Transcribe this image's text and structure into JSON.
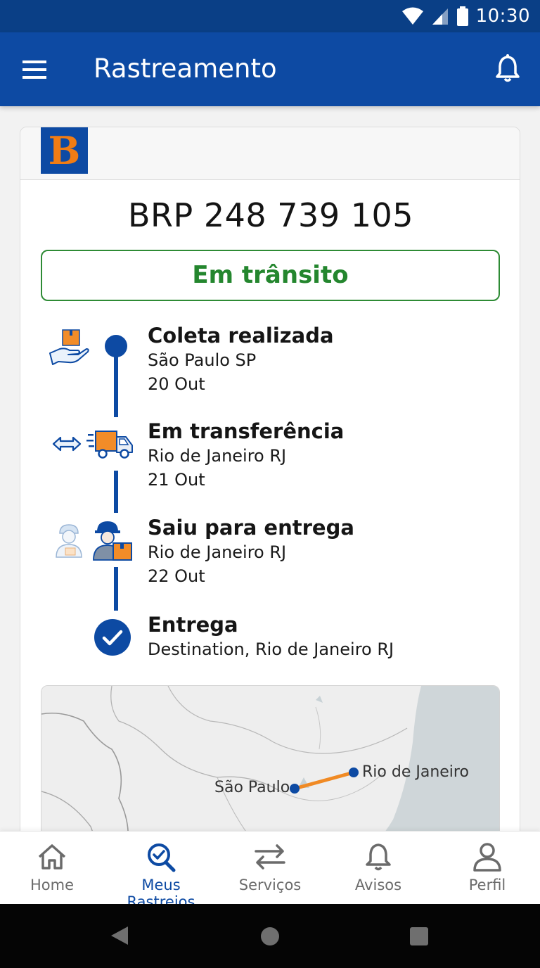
{
  "status_bar": {
    "time": "10:30"
  },
  "app_bar": {
    "title": "Rastreamento"
  },
  "card": {
    "logo_letter": "B",
    "tracking_number": "BRP 248 739 105",
    "status": "Em trânsito",
    "events": [
      {
        "title": "Coleta realizada",
        "location": "São Paulo SP",
        "date": "20 Out"
      },
      {
        "title": "Em transferência",
        "location": "Rio de Janeiro RJ",
        "date": "21 Out"
      },
      {
        "title": "Saiu para entrega",
        "location": "Rio de Janeiro RJ",
        "date": "22 Out"
      },
      {
        "title": "Entrega",
        "location": "Destination, Rio de Janeiro RJ"
      }
    ],
    "map": {
      "origin_label": "São Paulo",
      "destination_label": "Rio de Janeiro"
    }
  },
  "bottom_nav": [
    {
      "label": "Home",
      "icon": "home-icon",
      "active": false
    },
    {
      "label": "Meus Rastreios",
      "icon": "search-check-icon",
      "active": true
    },
    {
      "label": "Serviços",
      "icon": "swap-arrows-icon",
      "active": false
    },
    {
      "label": "Avisos",
      "icon": "bell-icon",
      "active": false
    },
    {
      "label": "Perfil",
      "icon": "person-icon",
      "active": false
    }
  ],
  "colors": {
    "primary": "#0d4aa3",
    "status_green": "#24862e",
    "accent_orange": "#f07c14"
  }
}
